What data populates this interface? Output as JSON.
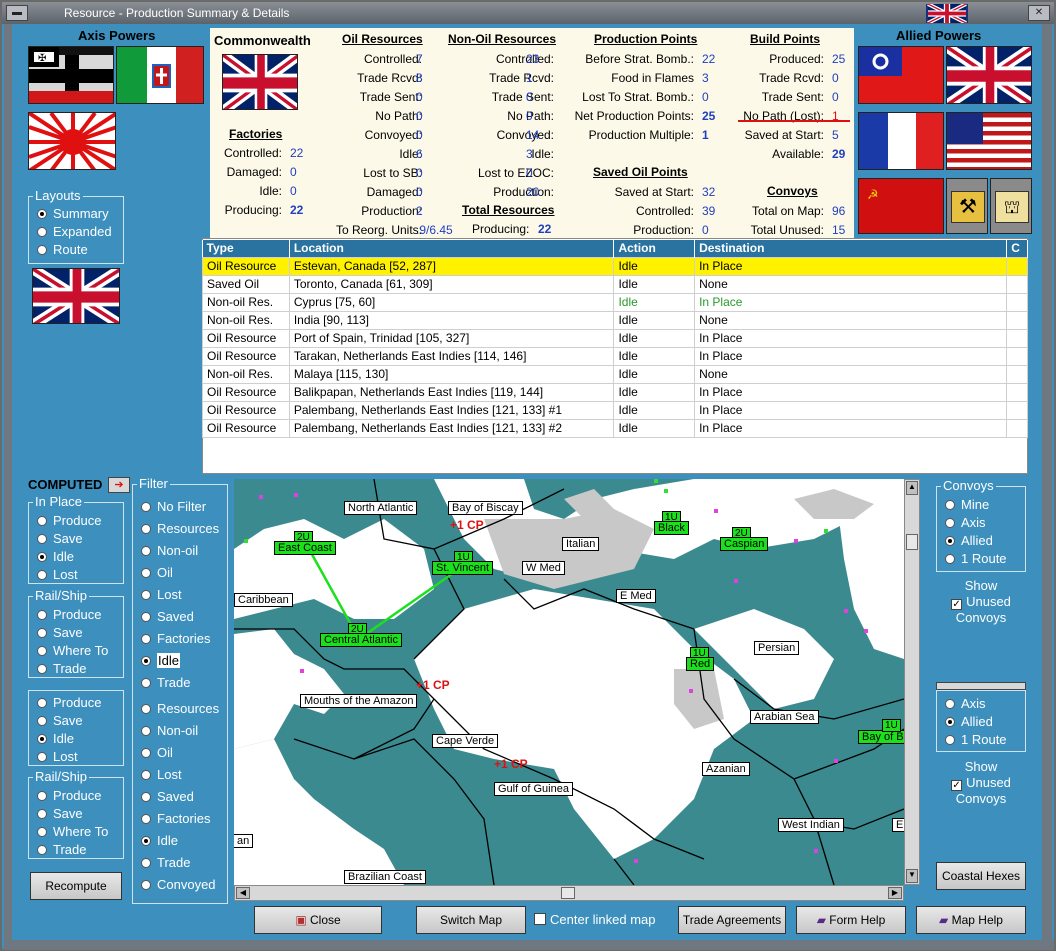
{
  "window": {
    "title": "Resource - Production Summary & Details"
  },
  "left": {
    "axis_title": "Axis Powers",
    "layouts": {
      "legend": "Layouts",
      "options": [
        "Summary",
        "Expanded",
        "Route"
      ],
      "selected": 0
    }
  },
  "right": {
    "allied_title": "Allied Powers"
  },
  "summary": {
    "nation": "Commonwealth",
    "oil": {
      "title": "Oil Resources",
      "rows": [
        [
          "Controlled:",
          "7"
        ],
        [
          "Trade Rcvd:",
          "8"
        ],
        [
          "Trade Sent:",
          "0"
        ],
        [
          "No Path:",
          "0"
        ],
        [
          "Convoyed:",
          "0"
        ],
        [
          "Idle:",
          "6"
        ],
        [
          "Lost to SB:",
          "0"
        ],
        [
          "Damaged:",
          "0"
        ],
        [
          "Production:",
          "2"
        ],
        [
          "To Reorg. Units:",
          ".9/6.45"
        ]
      ]
    },
    "nonoil": {
      "title": "Non-Oil Resources",
      "rows": [
        [
          "Controlled:",
          "23"
        ],
        [
          "Trade Rcvd:",
          "1"
        ],
        [
          "Trade Sent:",
          "0"
        ],
        [
          "No Path:",
          "0"
        ],
        [
          "Convoyed:",
          "14"
        ],
        [
          "Idle:",
          "3"
        ],
        [
          "Lost to EZOC:",
          "0"
        ],
        [
          "Production:",
          "20"
        ]
      ]
    },
    "total": {
      "title": "Total Resources",
      "label": "Producing:",
      "value": "22"
    },
    "factories": {
      "title": "Factories",
      "rows": [
        [
          "Controlled:",
          "22"
        ],
        [
          "Damaged:",
          "0"
        ],
        [
          "Idle:",
          "0"
        ],
        [
          "Producing:",
          "22"
        ]
      ]
    },
    "production_points": {
      "title": "Production Points",
      "rows": [
        [
          "Before Strat. Bomb.:",
          "22"
        ],
        [
          "Food in Flames",
          "3"
        ],
        [
          "Lost To Strat. Bomb.:",
          "0"
        ],
        [
          "Net Production Points:",
          "25"
        ],
        [
          "Production Multiple:",
          "1"
        ]
      ]
    },
    "saved_oil": {
      "title": "Saved Oil Points",
      "rows": [
        [
          "Saved at Start:",
          "32"
        ],
        [
          "Controlled:",
          "39"
        ],
        [
          "Production:",
          "0"
        ]
      ]
    },
    "build_points": {
      "title": "Build Points",
      "rows": [
        [
          "Produced:",
          "25"
        ],
        [
          "Trade Rcvd:",
          "0"
        ],
        [
          "Trade Sent:",
          "0"
        ],
        [
          "No Path (Lost):",
          "1"
        ],
        [
          "Saved at Start:",
          "5"
        ],
        [
          "Available:",
          "29"
        ]
      ]
    },
    "convoys": {
      "title": "Convoys",
      "rows": [
        [
          "Total on Map:",
          "96"
        ],
        [
          "Total Unused:",
          "15"
        ]
      ]
    }
  },
  "table": {
    "columns": [
      "Type",
      "Location",
      "Action",
      "Destination",
      "C"
    ],
    "rows": [
      [
        "Oil Resource",
        "Estevan, Canada [52, 287]",
        "Idle",
        "In Place"
      ],
      [
        "Saved Oil",
        "Toronto, Canada [61, 309]",
        "Idle",
        "None"
      ],
      [
        "Non-oil Res.",
        "Cyprus [75, 60]",
        "Idle",
        "In Place"
      ],
      [
        "Non-oil Res.",
        "India [90, 113]",
        "Idle",
        "None"
      ],
      [
        "Oil Resource",
        "Port of Spain, Trinidad [105, 327]",
        "Idle",
        "In Place"
      ],
      [
        "Oil Resource",
        "Tarakan, Netherlands East Indies [114, 146]",
        "Idle",
        "In Place"
      ],
      [
        "Non-oil Res.",
        "Malaya [115, 130]",
        "Idle",
        "None"
      ],
      [
        "Oil Resource",
        "Balikpapan, Netherlands East Indies [119, 144]",
        "Idle",
        "In Place"
      ],
      [
        "Oil Resource",
        "Palembang, Netherlands East Indies [121, 133] #1",
        "Idle",
        "In Place"
      ],
      [
        "Oil Resource",
        "Palembang, Netherlands East Indies [121, 133] #2",
        "Idle",
        "In Place"
      ]
    ]
  },
  "computed": {
    "label": "COMPUTED",
    "in_place": {
      "legend": "In Place",
      "options": [
        "Produce",
        "Save",
        "Idle",
        "Lost"
      ],
      "selected": 2
    },
    "rail_ship": {
      "legend": "Rail/Ship",
      "options": [
        "Produce",
        "Save",
        "Where To",
        "Trade"
      ]
    },
    "in_place2": {
      "options": [
        "Produce",
        "Save",
        "Idle",
        "Lost"
      ],
      "selected": 2
    },
    "rail_ship2": {
      "legend": "Rail/Ship",
      "options": [
        "Produce",
        "Save",
        "Where To",
        "Trade"
      ]
    },
    "recompute": "Recompute"
  },
  "filter": {
    "legend": "Filter",
    "options": [
      "No Filter",
      "Resources",
      "Non-oil",
      "Oil",
      "Lost",
      "Saved",
      "Factories",
      "Idle",
      "Trade"
    ],
    "selected": 7,
    "options2": [
      "Resources",
      "Non-oil",
      "Oil",
      "Lost",
      "Saved",
      "Factories",
      "Idle",
      "Trade",
      "Convoyed"
    ],
    "selected2": 6
  },
  "convoys_panel": {
    "legend": "Convoys",
    "options": [
      "Mine",
      "Axis",
      "Allied",
      "1 Route"
    ],
    "selected": 2,
    "show_unused": [
      "Show",
      "Unused",
      "Convoys"
    ],
    "options2": [
      "Axis",
      "Allied",
      "1 Route"
    ],
    "selected2": 1,
    "coastal": "Coastal Hexes"
  },
  "map": {
    "sea_labels": [
      "North Atlantic",
      "Bay of Biscay",
      "Italian",
      "W Med",
      "E Med",
      "Caribbean",
      "Persian",
      "Mouths of the Amazon",
      "Arabian Sea",
      "Cape Verde",
      "Gulf of Guinea",
      "Azanian",
      "West Indian",
      "Brazilian Coast",
      "Bay of B"
    ],
    "convoy_labels": [
      "East Coast",
      "St. Vincent",
      "Central Atlantic",
      "Black",
      "Caspian",
      "Red"
    ],
    "convoy_counts": [
      "2U",
      "1U",
      "2U",
      "1U",
      "2U",
      "1U",
      "1U"
    ],
    "cp_labels": [
      "+1 CP",
      "+1 CP",
      "+1 CP"
    ],
    "edge_labels": [
      "an",
      "E"
    ]
  },
  "bottom": {
    "close": "Close",
    "switch_map": "Switch Map",
    "center_linked": "Center linked map",
    "trade_agreements": "Trade Agreements",
    "form_help": "Form Help",
    "map_help": "Map Help"
  },
  "colors": {
    "panel_bg": "#3d8fbd",
    "selected_row": "#fff200",
    "value_blue": "#1f3fbf",
    "green_text": "#2a9a2a"
  }
}
